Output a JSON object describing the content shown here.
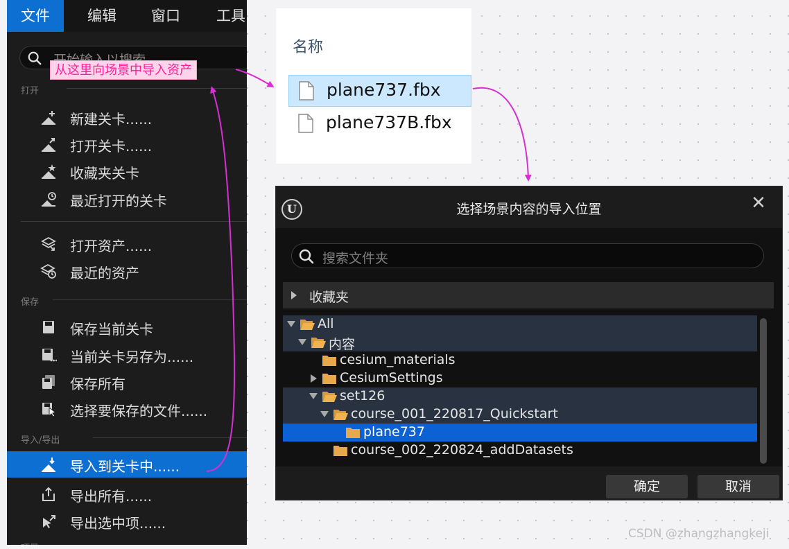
{
  "menu": {
    "menubar": [
      "文件",
      "编辑",
      "窗口",
      "工具"
    ],
    "search_placeholder": "开始输入以搜索",
    "callout": "从这里向场景中导入资产",
    "sections": {
      "open": "打开",
      "save": "保存",
      "import_export": "导入/导出",
      "more": "项目"
    },
    "items": [
      {
        "label": "新建关卡......",
        "icon": "new-level-icon"
      },
      {
        "label": "打开关卡......",
        "icon": "open-level-icon"
      },
      {
        "label": "收藏夹关卡",
        "icon": "favorite-level-icon"
      },
      {
        "label": "最近打开的关卡",
        "icon": "recent-level-icon"
      },
      {
        "label": "打开资产......",
        "icon": "open-asset-icon"
      },
      {
        "label": "最近的资产",
        "icon": "recent-asset-icon"
      },
      {
        "label": "保存当前关卡",
        "icon": "save-icon"
      },
      {
        "label": "当前关卡另存为......",
        "icon": "save-as-icon"
      },
      {
        "label": "保存所有",
        "icon": "save-all-icon"
      },
      {
        "label": "选择要保存的文件......",
        "icon": "choose-files-icon"
      },
      {
        "label": "导入到关卡中......",
        "icon": "import-icon"
      },
      {
        "label": "导出所有......",
        "icon": "export-all-icon"
      },
      {
        "label": "导出选中项......",
        "icon": "export-selected-icon"
      }
    ]
  },
  "files": {
    "header": "名称",
    "items": [
      "plane737.fbx",
      "plane737B.fbx"
    ]
  },
  "dialog": {
    "title": "选择场景内容的导入位置",
    "search_placeholder": "搜索文件夹",
    "favorites": "收藏夹",
    "tree": [
      {
        "label": "All",
        "expanded": true
      },
      {
        "label": "内容",
        "expanded": true
      },
      {
        "label": "cesium_materials",
        "expanded": false
      },
      {
        "label": "CesiumSettings",
        "expanded": false
      },
      {
        "label": "set126",
        "expanded": true
      },
      {
        "label": "course_001_220817_Quickstart",
        "expanded": true
      },
      {
        "label": "plane737",
        "expanded": false
      },
      {
        "label": "course_002_220824_addDatasets",
        "expanded": false
      }
    ],
    "ok": "确定",
    "cancel": "取消"
  },
  "watermark": "CSDN @zhangzhangkeji",
  "colors": {
    "accent_blue": "#0d6fd2",
    "annotation_magenta": "#d62fd1",
    "callout_text": "#ff1f9a",
    "folder": "#e7a84c"
  }
}
